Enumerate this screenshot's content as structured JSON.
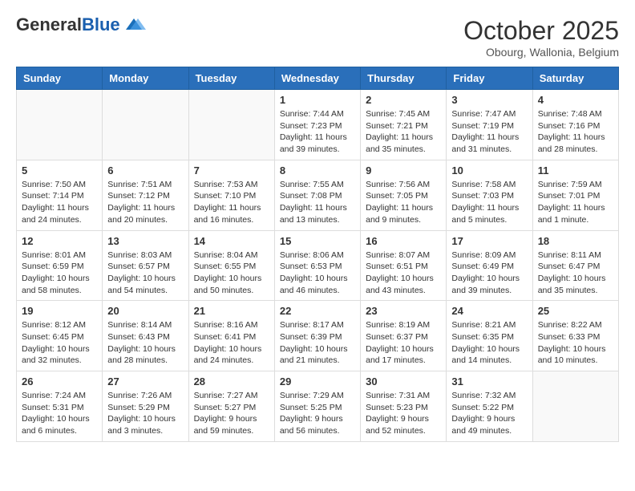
{
  "header": {
    "logo_general": "General",
    "logo_blue": "Blue",
    "month": "October 2025",
    "location": "Obourg, Wallonia, Belgium"
  },
  "days_of_week": [
    "Sunday",
    "Monday",
    "Tuesday",
    "Wednesday",
    "Thursday",
    "Friday",
    "Saturday"
  ],
  "weeks": [
    [
      {
        "day": "",
        "info": ""
      },
      {
        "day": "",
        "info": ""
      },
      {
        "day": "",
        "info": ""
      },
      {
        "day": "1",
        "info": "Sunrise: 7:44 AM\nSunset: 7:23 PM\nDaylight: 11 hours\nand 39 minutes."
      },
      {
        "day": "2",
        "info": "Sunrise: 7:45 AM\nSunset: 7:21 PM\nDaylight: 11 hours\nand 35 minutes."
      },
      {
        "day": "3",
        "info": "Sunrise: 7:47 AM\nSunset: 7:19 PM\nDaylight: 11 hours\nand 31 minutes."
      },
      {
        "day": "4",
        "info": "Sunrise: 7:48 AM\nSunset: 7:16 PM\nDaylight: 11 hours\nand 28 minutes."
      }
    ],
    [
      {
        "day": "5",
        "info": "Sunrise: 7:50 AM\nSunset: 7:14 PM\nDaylight: 11 hours\nand 24 minutes."
      },
      {
        "day": "6",
        "info": "Sunrise: 7:51 AM\nSunset: 7:12 PM\nDaylight: 11 hours\nand 20 minutes."
      },
      {
        "day": "7",
        "info": "Sunrise: 7:53 AM\nSunset: 7:10 PM\nDaylight: 11 hours\nand 16 minutes."
      },
      {
        "day": "8",
        "info": "Sunrise: 7:55 AM\nSunset: 7:08 PM\nDaylight: 11 hours\nand 13 minutes."
      },
      {
        "day": "9",
        "info": "Sunrise: 7:56 AM\nSunset: 7:05 PM\nDaylight: 11 hours\nand 9 minutes."
      },
      {
        "day": "10",
        "info": "Sunrise: 7:58 AM\nSunset: 7:03 PM\nDaylight: 11 hours\nand 5 minutes."
      },
      {
        "day": "11",
        "info": "Sunrise: 7:59 AM\nSunset: 7:01 PM\nDaylight: 11 hours\nand 1 minute."
      }
    ],
    [
      {
        "day": "12",
        "info": "Sunrise: 8:01 AM\nSunset: 6:59 PM\nDaylight: 10 hours\nand 58 minutes."
      },
      {
        "day": "13",
        "info": "Sunrise: 8:03 AM\nSunset: 6:57 PM\nDaylight: 10 hours\nand 54 minutes."
      },
      {
        "day": "14",
        "info": "Sunrise: 8:04 AM\nSunset: 6:55 PM\nDaylight: 10 hours\nand 50 minutes."
      },
      {
        "day": "15",
        "info": "Sunrise: 8:06 AM\nSunset: 6:53 PM\nDaylight: 10 hours\nand 46 minutes."
      },
      {
        "day": "16",
        "info": "Sunrise: 8:07 AM\nSunset: 6:51 PM\nDaylight: 10 hours\nand 43 minutes."
      },
      {
        "day": "17",
        "info": "Sunrise: 8:09 AM\nSunset: 6:49 PM\nDaylight: 10 hours\nand 39 minutes."
      },
      {
        "day": "18",
        "info": "Sunrise: 8:11 AM\nSunset: 6:47 PM\nDaylight: 10 hours\nand 35 minutes."
      }
    ],
    [
      {
        "day": "19",
        "info": "Sunrise: 8:12 AM\nSunset: 6:45 PM\nDaylight: 10 hours\nand 32 minutes."
      },
      {
        "day": "20",
        "info": "Sunrise: 8:14 AM\nSunset: 6:43 PM\nDaylight: 10 hours\nand 28 minutes."
      },
      {
        "day": "21",
        "info": "Sunrise: 8:16 AM\nSunset: 6:41 PM\nDaylight: 10 hours\nand 24 minutes."
      },
      {
        "day": "22",
        "info": "Sunrise: 8:17 AM\nSunset: 6:39 PM\nDaylight: 10 hours\nand 21 minutes."
      },
      {
        "day": "23",
        "info": "Sunrise: 8:19 AM\nSunset: 6:37 PM\nDaylight: 10 hours\nand 17 minutes."
      },
      {
        "day": "24",
        "info": "Sunrise: 8:21 AM\nSunset: 6:35 PM\nDaylight: 10 hours\nand 14 minutes."
      },
      {
        "day": "25",
        "info": "Sunrise: 8:22 AM\nSunset: 6:33 PM\nDaylight: 10 hours\nand 10 minutes."
      }
    ],
    [
      {
        "day": "26",
        "info": "Sunrise: 7:24 AM\nSunset: 5:31 PM\nDaylight: 10 hours\nand 6 minutes."
      },
      {
        "day": "27",
        "info": "Sunrise: 7:26 AM\nSunset: 5:29 PM\nDaylight: 10 hours\nand 3 minutes."
      },
      {
        "day": "28",
        "info": "Sunrise: 7:27 AM\nSunset: 5:27 PM\nDaylight: 9 hours\nand 59 minutes."
      },
      {
        "day": "29",
        "info": "Sunrise: 7:29 AM\nSunset: 5:25 PM\nDaylight: 9 hours\nand 56 minutes."
      },
      {
        "day": "30",
        "info": "Sunrise: 7:31 AM\nSunset: 5:23 PM\nDaylight: 9 hours\nand 52 minutes."
      },
      {
        "day": "31",
        "info": "Sunrise: 7:32 AM\nSunset: 5:22 PM\nDaylight: 9 hours\nand 49 minutes."
      },
      {
        "day": "",
        "info": ""
      }
    ]
  ]
}
